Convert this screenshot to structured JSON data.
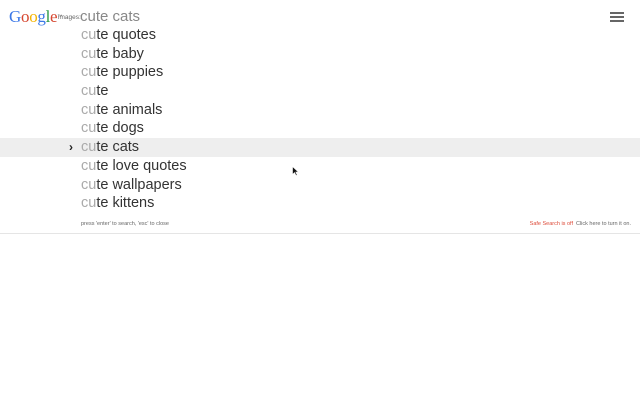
{
  "header": {
    "logo": {
      "letters": [
        {
          "char": "G",
          "color": "#3b78e7"
        },
        {
          "char": "o",
          "color": "#d6462f"
        },
        {
          "char": "o",
          "color": "#f4b400"
        },
        {
          "char": "g",
          "color": "#3b78e7"
        },
        {
          "char": "l",
          "color": "#2a9a45"
        },
        {
          "char": "e",
          "color": "#d6462f"
        }
      ],
      "tm": "™"
    },
    "section_label": "images:",
    "search_value": "cute cats"
  },
  "suggestions": {
    "items": [
      {
        "prefix": "cu",
        "rest": "te quotes",
        "selected": false
      },
      {
        "prefix": "cu",
        "rest": "te baby",
        "selected": false
      },
      {
        "prefix": "cu",
        "rest": "te puppies",
        "selected": false
      },
      {
        "prefix": "cu",
        "rest": "te",
        "selected": false
      },
      {
        "prefix": "cu",
        "rest": "te animals",
        "selected": false
      },
      {
        "prefix": "cu",
        "rest": "te dogs",
        "selected": false
      },
      {
        "prefix": "cu",
        "rest": "te cats",
        "selected": true
      },
      {
        "prefix": "cu",
        "rest": "te love quotes",
        "selected": false
      },
      {
        "prefix": "cu",
        "rest": "te wallpapers",
        "selected": false
      },
      {
        "prefix": "cu",
        "rest": "te kittens",
        "selected": false
      }
    ],
    "selected_marker": "›"
  },
  "footer": {
    "hint": "press 'enter' to search, 'esc' to close",
    "safesearch_status": "Safe Search is off",
    "safesearch_action": "Click here to turn it on."
  },
  "icons": {
    "menu": "hamburger-menu-icon",
    "cursor": "mouse-pointer-icon"
  }
}
